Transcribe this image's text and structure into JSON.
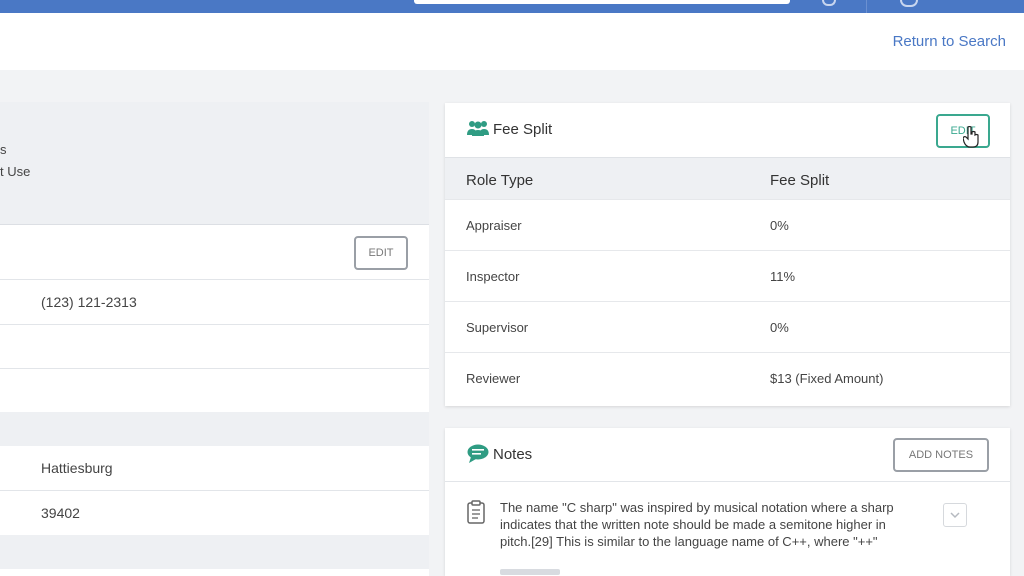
{
  "header": {
    "return_link": "Return to Search"
  },
  "left_panel": {
    "fragment_1": "s",
    "fragment_2": "t Use",
    "edit_label": "EDIT",
    "phone": "(123) 121-2313",
    "city": "Hattiesburg",
    "zip": "39402"
  },
  "fee_split": {
    "title": "Fee Split",
    "edit_label": "EDIT",
    "columns": [
      "Role Type",
      "Fee Split"
    ],
    "rows": [
      {
        "role": "Appraiser",
        "split": "0%"
      },
      {
        "role": "Inspector",
        "split": "11%"
      },
      {
        "role": "Supervisor",
        "split": "0%"
      },
      {
        "role": "Reviewer",
        "split": "$13 (Fixed Amount)"
      }
    ]
  },
  "notes": {
    "title": "Notes",
    "add_label": "ADD NOTES",
    "note_text": "The name \"C sharp\" was inspired by musical notation where a sharp indicates that the written note should be made a semitone higher in pitch.[29] This is similar to the language name of C++, where \"++\""
  },
  "colors": {
    "topbar": "#4a78c5",
    "accent_green": "#3aa88f",
    "link": "#4a78c5"
  }
}
